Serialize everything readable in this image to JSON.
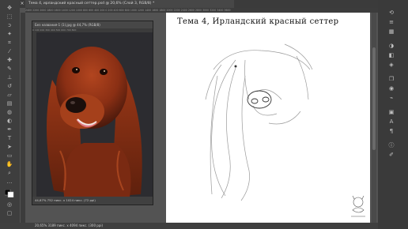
{
  "window": {
    "doc_tab_title": "Тема 4, ирландский красный сеттер.psd @ 20,6% (Слой 3, RGB/8) *",
    "close_glyph": "×"
  },
  "rulers": {
    "top_ticks": "2400  2200  2000  1800  1600  1400  1200  1000  800  600  400  200  0  200  400  600  800  1000  1200  1400  1600  1800  2000  2200  2400  2600  2800  3000  3200  3400  3600"
  },
  "reference_window": {
    "tab_title": "Без названия-1 (1).jpg @ 44,7% (RGB/8)",
    "ruler_ticks": "0   100   200   300   400   500   600   700   800",
    "status": "44,67%     752 пикс. x 1024 пикс. (72 ppi)"
  },
  "sketch": {
    "title": "Тема 4, Ирландский красный сеттер"
  },
  "statusbar": {
    "text": "20,65%     3189 пикс. x 4094 пикс. (300 ppi)"
  },
  "toolbar": {
    "icons": [
      "move-tool-icon",
      "marquee-tool-icon",
      "lasso-tool-icon",
      "magic-wand-icon",
      "crop-tool-icon",
      "eyedropper-icon",
      "healing-brush-icon",
      "brush-tool-icon",
      "clone-stamp-icon",
      "history-brush-icon",
      "eraser-icon",
      "gradient-tool-icon",
      "blur-tool-icon",
      "dodge-tool-icon",
      "pen-tool-icon",
      "type-tool-icon",
      "path-select-icon",
      "shape-tool-icon",
      "hand-tool-icon",
      "zoom-tool-icon",
      "more-tools-icon",
      "color-swatches-icon",
      "quick-mask-icon",
      "screen-mode-icon"
    ]
  },
  "right_panel": {
    "icons": [
      "history-panel-icon",
      "properties-panel-icon",
      "swatches-panel-icon",
      "color-panel-icon",
      "adjustments-panel-icon",
      "styles-panel-icon",
      "layers-panel-icon",
      "channels-panel-icon",
      "paths-panel-icon",
      "libraries-panel-icon",
      "character-panel-icon",
      "paragraph-panel-icon",
      "info-panel-icon",
      "brush-settings-icon"
    ]
  }
}
